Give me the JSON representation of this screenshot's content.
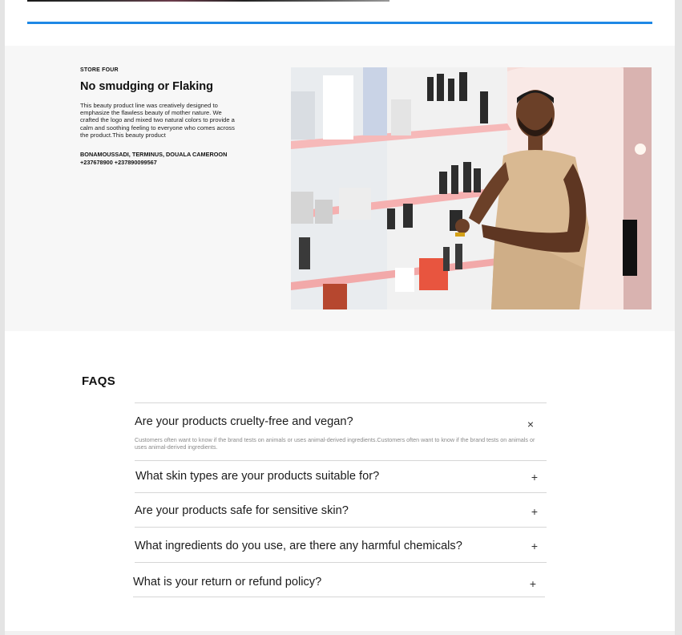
{
  "store": {
    "label": "STORE FOUR",
    "title": "No smudging or Flaking",
    "description": "This beauty product line was creatively designed to emphasize the flawless beauty of mother nature. We crafted the logo and mixed two natural colors to provide a calm and soothing feeling to everyone who comes across the product.This beauty product",
    "address_line1": "BONAMOUSSADI, TERMINUS, DOUALA CAMEROON",
    "address_line2": "+237678900 +237890099567"
  },
  "faq": {
    "title": "FAQS",
    "items": [
      {
        "question": "Are your products cruelty-free and vegan?",
        "icon": "close-icon",
        "icon_glyph": "×",
        "expanded": true,
        "answer": "Customers often want to know if the brand tests on animals or uses animal-derived ingredients.Customers often want to know if the brand tests on animals or uses animal-derived ingredients."
      },
      {
        "question": "What skin types are your products suitable for?",
        "icon": "plus-icon",
        "icon_glyph": "+",
        "expanded": false
      },
      {
        "question": "Are your products safe for sensitive skin?",
        "icon": "plus-icon",
        "icon_glyph": "+",
        "expanded": false
      },
      {
        "question": "What ingredients do you use, are there any harmful chemicals?",
        "icon": "plus-icon",
        "icon_glyph": "+",
        "expanded": false
      },
      {
        "question": "What is your return or refund policy?",
        "icon": "plus-icon",
        "icon_glyph": "+",
        "expanded": false
      }
    ]
  },
  "colors": {
    "accent_rule": "#1e88e5",
    "section_bg": "#f7f7f7"
  }
}
